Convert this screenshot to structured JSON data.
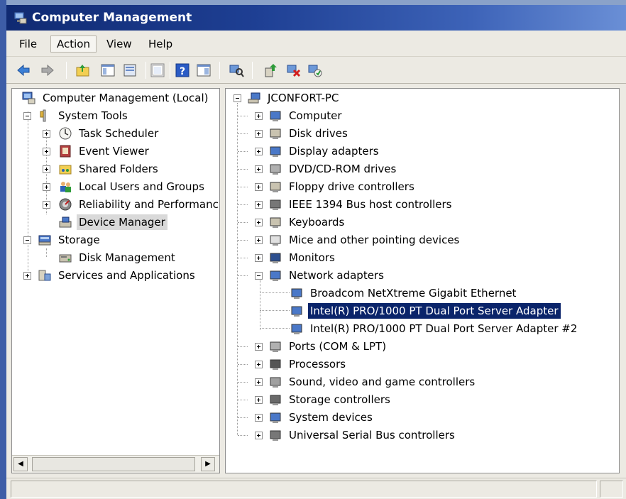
{
  "window": {
    "title": "Computer Management"
  },
  "menu": [
    "File",
    "Action",
    "View",
    "Help"
  ],
  "toolbar": [
    "back-icon",
    "forward-icon",
    "up-folder-icon",
    "show-hide-tree-icon",
    "properties-icon",
    "help-icon",
    "show-hide-action-pane-icon",
    "scan-hardware-icon",
    "update-driver-icon",
    "disable-device-icon",
    "uninstall-device-icon"
  ],
  "left_tree": {
    "root": "Computer Management (Local)",
    "system_tools": "System Tools",
    "task_scheduler": "Task Scheduler",
    "event_viewer": "Event Viewer",
    "shared_folders": "Shared Folders",
    "local_users": "Local Users and Groups",
    "reliability": "Reliability and Performanc",
    "device_manager": "Device Manager",
    "storage": "Storage",
    "disk_management": "Disk Management",
    "services_apps": "Services and Applications"
  },
  "right_tree": {
    "root": "JCONFORT-PC",
    "categories": [
      "Computer",
      "Disk drives",
      "Display adapters",
      "DVD/CD-ROM drives",
      "Floppy drive controllers",
      "IEEE 1394 Bus host controllers",
      "Keyboards",
      "Mice and other pointing devices",
      "Monitors",
      "Network adapters",
      "Ports (COM & LPT)",
      "Processors",
      "Sound, video and game controllers",
      "Storage controllers",
      "System devices",
      "Universal Serial Bus controllers"
    ],
    "network_adapters": [
      "Broadcom NetXtreme Gigabit Ethernet",
      "Intel(R) PRO/1000 PT Dual Port Server Adapter",
      "Intel(R) PRO/1000 PT Dual Port Server Adapter #2"
    ],
    "selected_device": "Intel(R) PRO/1000 PT Dual Port Server Adapter"
  },
  "colors": {
    "selection": "#0a246a",
    "title_bar": "#1e3f93"
  }
}
